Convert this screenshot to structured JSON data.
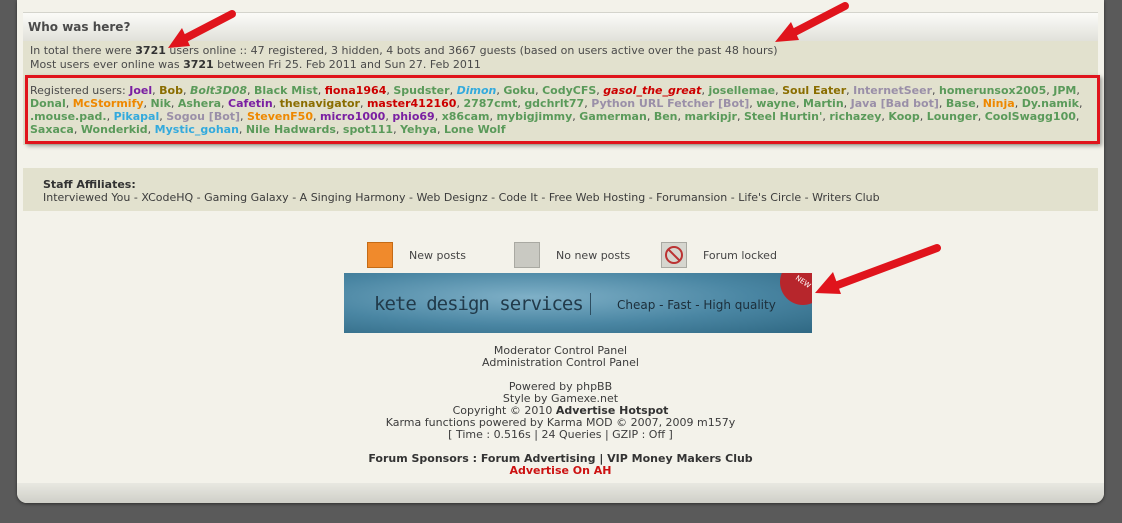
{
  "whohere": {
    "title": "Who was here?",
    "line1_pre": "In total there were ",
    "line1_count": "3721",
    "line1_post": " users online :: 47 registered, 3 hidden, 4 bots and 3667 guests (based on users active over the past 48 hours)",
    "line2_pre": "Most users ever online was ",
    "line2_count": "3721",
    "line2_post": " between Fri 25. Feb 2011 and Sun 27. Feb 2011"
  },
  "registered": {
    "label": "Registered users:",
    "users": [
      {
        "name": "Joel",
        "color": "#7a1fa2",
        "italic": false
      },
      {
        "name": "Bob",
        "color": "#8a6d00",
        "italic": false
      },
      {
        "name": "Bolt3D08",
        "color": "#5a9a5a",
        "italic": true
      },
      {
        "name": "Black Mist",
        "color": "#5a9a5a",
        "italic": false
      },
      {
        "name": "fiona1964",
        "color": "#cc0000",
        "italic": false
      },
      {
        "name": "Spudster",
        "color": "#5a9a5a",
        "italic": false
      },
      {
        "name": "Dimon",
        "color": "#33aadd",
        "italic": true
      },
      {
        "name": "Goku",
        "color": "#5a9a5a",
        "italic": false
      },
      {
        "name": "CodyCFS",
        "color": "#5a9a5a",
        "italic": false
      },
      {
        "name": "gasol_the_great",
        "color": "#cc0000",
        "italic": true
      },
      {
        "name": "josellemae",
        "color": "#5a9a5a",
        "italic": false
      },
      {
        "name": "Soul Eater",
        "color": "#8a6d00",
        "italic": false
      },
      {
        "name": "InternetSeer",
        "color": "#9a8fa8",
        "italic": false
      },
      {
        "name": "homerunsox2005",
        "color": "#5a9a5a",
        "italic": false
      },
      {
        "name": "JPM",
        "color": "#5a9a5a",
        "italic": false
      },
      {
        "name": "Donal",
        "color": "#5a9a5a",
        "italic": false
      },
      {
        "name": "McStormify",
        "color": "#ee8800",
        "italic": false
      },
      {
        "name": "Nik",
        "color": "#5a9a5a",
        "italic": false
      },
      {
        "name": "Ashera",
        "color": "#5a9a5a",
        "italic": false
      },
      {
        "name": "Cafetin",
        "color": "#7a1fa2",
        "italic": false
      },
      {
        "name": "thenavigator",
        "color": "#8a6d00",
        "italic": false
      },
      {
        "name": "master412160",
        "color": "#cc0000",
        "italic": false
      },
      {
        "name": "2787cmt",
        "color": "#5a9a5a",
        "italic": false
      },
      {
        "name": "gdchrlt77",
        "color": "#5a9a5a",
        "italic": false
      },
      {
        "name": "Python URL Fetcher [Bot]",
        "color": "#9a8fa8",
        "italic": false
      },
      {
        "name": "wayne",
        "color": "#5a9a5a",
        "italic": false
      },
      {
        "name": "Martin",
        "color": "#5a9a5a",
        "italic": false
      },
      {
        "name": "Java [Bad bot]",
        "color": "#9a8fa8",
        "italic": false
      },
      {
        "name": "Base",
        "color": "#5a9a5a",
        "italic": false
      },
      {
        "name": "Ninja",
        "color": "#ee8800",
        "italic": false
      },
      {
        "name": "Dy.namik",
        "color": "#5a9a5a",
        "italic": false
      },
      {
        "name": ".mouse.pad.",
        "color": "#5a9a5a",
        "italic": false
      },
      {
        "name": "Pikapal",
        "color": "#33aadd",
        "italic": false
      },
      {
        "name": "Sogou [Bot]",
        "color": "#9a8fa8",
        "italic": false
      },
      {
        "name": "StevenF50",
        "color": "#ee8800",
        "italic": false
      },
      {
        "name": "micro1000",
        "color": "#7a1fa2",
        "italic": false
      },
      {
        "name": "phio69",
        "color": "#7a1fa2",
        "italic": false
      },
      {
        "name": "x86cam",
        "color": "#5a9a5a",
        "italic": false
      },
      {
        "name": "mybigjimmy",
        "color": "#5a9a5a",
        "italic": false
      },
      {
        "name": "Gamerman",
        "color": "#5a9a5a",
        "italic": false
      },
      {
        "name": "Ben",
        "color": "#5a9a5a",
        "italic": false
      },
      {
        "name": "markipjr",
        "color": "#5a9a5a",
        "italic": false
      },
      {
        "name": "Steel Hurtin'",
        "color": "#5a9a5a",
        "italic": false
      },
      {
        "name": "richazey",
        "color": "#5a9a5a",
        "italic": false
      },
      {
        "name": "Koop",
        "color": "#5a9a5a",
        "italic": false
      },
      {
        "name": "Lounger",
        "color": "#5a9a5a",
        "italic": false
      },
      {
        "name": "CoolSwagg100",
        "color": "#5a9a5a",
        "italic": false
      },
      {
        "name": "Saxaca",
        "color": "#5a9a5a",
        "italic": false
      },
      {
        "name": "Wonderkid",
        "color": "#5a9a5a",
        "italic": false
      },
      {
        "name": "Mystic_gohan",
        "color": "#33aadd",
        "italic": false
      },
      {
        "name": "Nile Hadwards",
        "color": "#5a9a5a",
        "italic": false
      },
      {
        "name": "spot111",
        "color": "#5a9a5a",
        "italic": false
      },
      {
        "name": "Yehya",
        "color": "#5a9a5a",
        "italic": false
      },
      {
        "name": "Lone Wolf",
        "color": "#5a9a5a",
        "italic": false
      }
    ]
  },
  "affiliates": {
    "title": "Staff Affiliates:",
    "links": [
      "Interviewed You",
      "XCodeHQ",
      "Gaming Galaxy",
      "A Singing Harmony",
      "Web Designz",
      "Code It",
      "Free Web Hosting",
      "Forumansion",
      "Life's Circle",
      "Writers Club"
    ]
  },
  "legend": [
    {
      "label": "New posts",
      "icon": "new-posts-icon",
      "color": "#f08a2c"
    },
    {
      "label": "No new posts",
      "icon": "no-new-posts-icon",
      "color": "#c9c9c2"
    },
    {
      "label": "Forum locked",
      "icon": "forum-locked-icon",
      "color": "#d6d6cf"
    }
  ],
  "banner": {
    "text1": "kete design services",
    "text2": "Cheap - Fast - High quality",
    "ribbon": "NEW"
  },
  "footer": {
    "mcp": "Moderator Control Panel",
    "acp": "Administration Control Panel",
    "powered": "Powered by phpBB",
    "style": "Style by Gamexe.net",
    "copyright_pre": "Copyright © 2010 ",
    "copyright_site": "Advertise Hotspot",
    "karma": "Karma functions powered by Karma MOD © 2007, 2009 m157y",
    "stats": "[ Time : 0.516s | 24 Queries | GZIP : Off ]",
    "sponsors_label": "Forum Sponsors : ",
    "sponsor1": "Forum Advertising",
    "sponsor_sep": " | ",
    "sponsor2": "VIP Money Makers Club",
    "advertise": "Advertise On AH"
  },
  "colors": {
    "accent_red": "#e0141c",
    "panel": "#e2e1ce",
    "page": "#f3f2ea"
  }
}
